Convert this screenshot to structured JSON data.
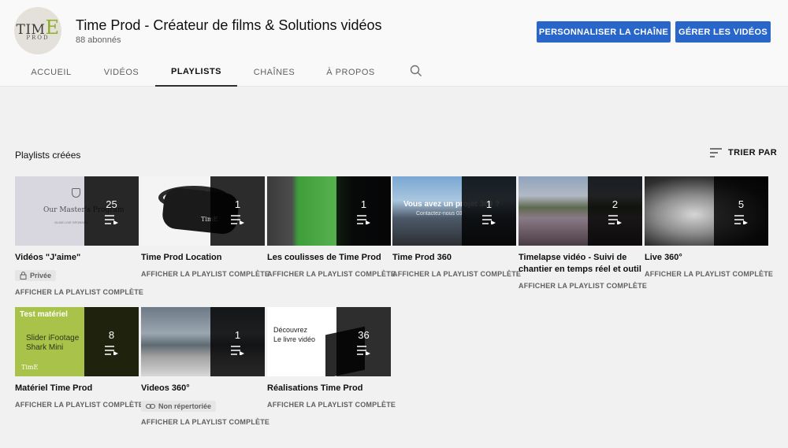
{
  "channel": {
    "name": "Time Prod - Créateur de films & Solutions vidéos",
    "subscribers": "88 abonnés",
    "avatar": {
      "main": "TIM",
      "accent": "E",
      "sub": "PROD"
    },
    "buttons": {
      "customize": "PERSONNALISER LA CHAÎNE",
      "manage": "GÉRER LES VIDÉOS"
    },
    "accent_color": "#2866c9"
  },
  "tabs": [
    {
      "label": "ACCUEIL"
    },
    {
      "label": "VIDÉOS"
    },
    {
      "label": "PLAYLISTS"
    },
    {
      "label": "CHAÎNES"
    },
    {
      "label": "À PROPOS"
    }
  ],
  "active_tab": "PLAYLISTS",
  "section": {
    "title": "Playlists créées",
    "sort_label": "TRIER PAR"
  },
  "playlists": [
    {
      "title": "Vidéos \"J'aime\"",
      "count": "25",
      "badge": "Privée",
      "link": "AFFICHER LA PLAYLIST COMPLÈTE",
      "thumb_text": "Our Master's Program",
      "thumb_sub": "GLIDE LIVE SPONSOR"
    },
    {
      "title": "Time Prod Location",
      "count": "1",
      "link": "AFFICHER LA PLAYLIST COMPLÈTE",
      "thumb_text": "TimE"
    },
    {
      "title": "Les coulisses de Time Prod",
      "count": "1",
      "link": "AFFICHER LA PLAYLIST COMPLÈTE"
    },
    {
      "title": "Time Prod 360",
      "count": "1",
      "link": "AFFICHER LA PLAYLIST COMPLÈTE",
      "thumb_text": "Vous avez un projet 360 ?",
      "thumb_sub": "Contactez-nous 03"
    },
    {
      "title": "Timelapse vidéo - Suivi de chantier en temps réel et outil d...",
      "count": "2",
      "link": "AFFICHER LA PLAYLIST COMPLÈTE"
    },
    {
      "title": "Live 360°",
      "count": "5",
      "link": "AFFICHER LA PLAYLIST COMPLÈTE"
    },
    {
      "title": "Matériel Time Prod",
      "count": "8",
      "link": "AFFICHER LA PLAYLIST COMPLÈTE",
      "thumb_label": "Test matériel",
      "thumb_line1": "Slider iFootage",
      "thumb_line2": "Shark Mini",
      "thumb_logo": "TimE"
    },
    {
      "title": "Videos 360°",
      "count": "1",
      "badge": "Non répertoriée",
      "link": "AFFICHER LA PLAYLIST COMPLÈTE"
    },
    {
      "title": "Réalisations Time Prod",
      "count": "36",
      "link": "AFFICHER LA PLAYLIST COMPLÈTE",
      "thumb_line1": "Découvrez",
      "thumb_line2": "Le livre vidéo"
    }
  ]
}
